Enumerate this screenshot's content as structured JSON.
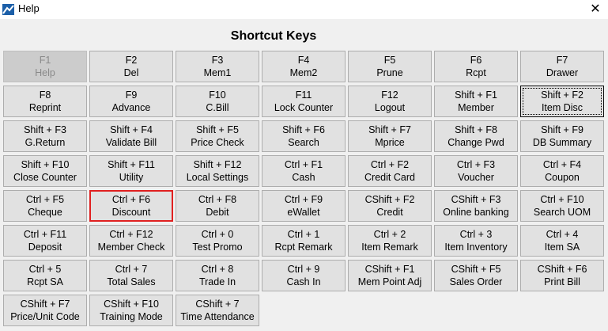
{
  "window": {
    "title": "Help",
    "close_glyph": "✕"
  },
  "heading": "Shortcut Keys",
  "keys": [
    {
      "key": "F1",
      "action": "Help",
      "state": "disabled"
    },
    {
      "key": "F2",
      "action": "Del"
    },
    {
      "key": "F3",
      "action": "Mem1"
    },
    {
      "key": "F4",
      "action": "Mem2"
    },
    {
      "key": "F5",
      "action": "Prune"
    },
    {
      "key": "F6",
      "action": "Rcpt"
    },
    {
      "key": "F7",
      "action": "Drawer"
    },
    {
      "key": "F8",
      "action": "Reprint"
    },
    {
      "key": "F9",
      "action": "Advance"
    },
    {
      "key": "F10",
      "action": "C.Bill"
    },
    {
      "key": "F11",
      "action": "Lock Counter"
    },
    {
      "key": "F12",
      "action": "Logout"
    },
    {
      "key": "Shift + F1",
      "action": "Member"
    },
    {
      "key": "Shift + F2",
      "action": "Item Disc",
      "state": "focused"
    },
    {
      "key": "Shift + F3",
      "action": "G.Return"
    },
    {
      "key": "Shift + F4",
      "action": "Validate Bill"
    },
    {
      "key": "Shift + F5",
      "action": "Price Check"
    },
    {
      "key": "Shift + F6",
      "action": "Search"
    },
    {
      "key": "Shift + F7",
      "action": "Mprice"
    },
    {
      "key": "Shift + F8",
      "action": "Change Pwd"
    },
    {
      "key": "Shift + F9",
      "action": "DB Summary"
    },
    {
      "key": "Shift + F10",
      "action": "Close Counter"
    },
    {
      "key": "Shift + F11",
      "action": "Utility"
    },
    {
      "key": "Shift + F12",
      "action": "Local Settings"
    },
    {
      "key": "Ctrl + F1",
      "action": "Cash"
    },
    {
      "key": "Ctrl + F2",
      "action": "Credit Card"
    },
    {
      "key": "Ctrl + F3",
      "action": "Voucher"
    },
    {
      "key": "Ctrl + F4",
      "action": "Coupon"
    },
    {
      "key": "Ctrl + F5",
      "action": "Cheque"
    },
    {
      "key": "Ctrl + F6",
      "action": "Discount",
      "state": "highlighted"
    },
    {
      "key": "Ctrl + F8",
      "action": "Debit"
    },
    {
      "key": "Ctrl + F9",
      "action": "eWallet"
    },
    {
      "key": "CShift + F2",
      "action": "Credit"
    },
    {
      "key": "CShift + F3",
      "action": "Online banking"
    },
    {
      "key": "Ctrl + F10",
      "action": "Search UOM"
    },
    {
      "key": "Ctrl + F11",
      "action": "Deposit"
    },
    {
      "key": "Ctrl + F12",
      "action": "Member Check"
    },
    {
      "key": "Ctrl + 0",
      "action": "Test Promo"
    },
    {
      "key": "Ctrl + 1",
      "action": "Rcpt Remark"
    },
    {
      "key": "Ctrl + 2",
      "action": "Item Remark"
    },
    {
      "key": "Ctrl + 3",
      "action": "Item Inventory"
    },
    {
      "key": "Ctrl + 4",
      "action": "Item SA"
    },
    {
      "key": "Ctrl + 5",
      "action": "Rcpt SA"
    },
    {
      "key": "Ctrl + 7",
      "action": "Total Sales"
    },
    {
      "key": "Ctrl + 8",
      "action": "Trade In"
    },
    {
      "key": "Ctrl + 9",
      "action": "Cash In"
    },
    {
      "key": "CShift + F1",
      "action": "Mem Point Adj"
    },
    {
      "key": "CShift + F5",
      "action": "Sales Order"
    },
    {
      "key": "CShift + F6",
      "action": "Print Bill"
    },
    {
      "key": "CShift + F7",
      "action": "Price/Unit Code"
    },
    {
      "key": "CShift + F10",
      "action": "Training Mode"
    },
    {
      "key": "CShift + 7",
      "action": "Time Attendance"
    }
  ]
}
